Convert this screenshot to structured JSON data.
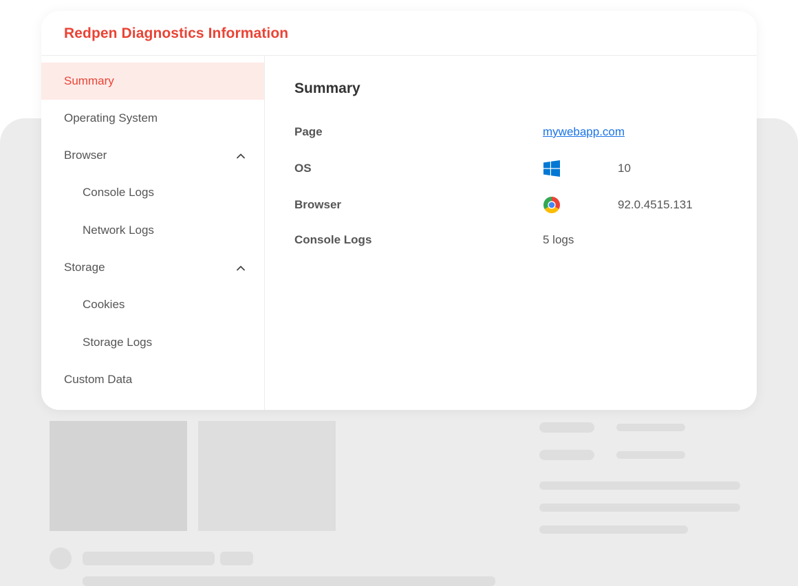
{
  "dialog": {
    "title": "Redpen Diagnostics Information"
  },
  "sidebar": {
    "items": [
      {
        "label": "Summary",
        "active": true
      },
      {
        "label": "Operating System"
      },
      {
        "label": "Browser",
        "expanded": true
      },
      {
        "label": "Console Logs",
        "sub": true
      },
      {
        "label": "Network Logs",
        "sub": true
      },
      {
        "label": "Storage",
        "expanded": true
      },
      {
        "label": "Cookies",
        "sub": true
      },
      {
        "label": "Storage Logs",
        "sub": true
      },
      {
        "label": "Custom Data"
      }
    ]
  },
  "summary": {
    "title": "Summary",
    "page_label": "Page",
    "page_value": "mywebapp.com",
    "os_label": "OS",
    "os_icon": "windows-logo-icon",
    "os_value": "10",
    "browser_label": "Browser",
    "browser_icon": "chrome-logo-icon",
    "browser_value": "92.0.4515.131",
    "console_label": "Console Logs",
    "console_value": "5 logs"
  },
  "colors": {
    "accent": "#ea4335",
    "active_bg": "#fdebe8",
    "link": "#1a73e8",
    "text": "#555555"
  }
}
